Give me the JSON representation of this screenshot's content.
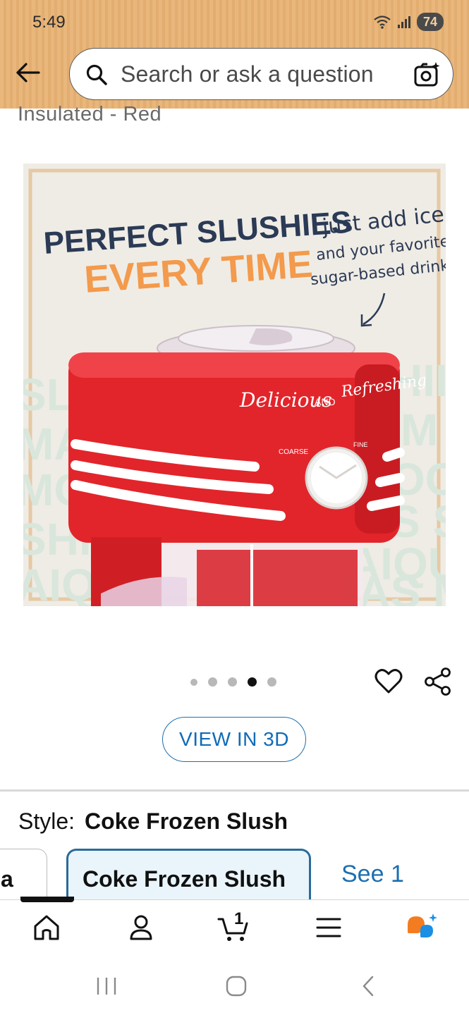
{
  "status_bar": {
    "time": "5:49",
    "battery": "74"
  },
  "search": {
    "placeholder": "Search or ask a question"
  },
  "product": {
    "title_partial": "Insulated - Red",
    "image": {
      "headline_line1": "PERFECT SLUSHIES",
      "headline_line2": "EVERY TIME",
      "note_line1": "just add ice",
      "note_line2": "and your favorite",
      "note_line3": "sugar-based drink",
      "machine_script_1": "Delicious",
      "machine_script_and": "AND",
      "machine_script_2": "Refreshing",
      "dial_left": "COARSE",
      "dial_right": "FINE"
    }
  },
  "carousel": {
    "dot_count": 5,
    "active_index": 3
  },
  "view_3d": {
    "label": "VIEW IN 3D"
  },
  "style": {
    "label": "Style:",
    "value": "Coke Frozen Slush",
    "options": [
      {
        "label": "a",
        "selected": false
      },
      {
        "label": "Coke Frozen Slush",
        "selected": true
      }
    ],
    "see_more": "See 1"
  },
  "bottom_nav": {
    "items": [
      "home-icon",
      "account-icon",
      "cart-icon",
      "menu-icon",
      "rufus-icon"
    ],
    "cart_count": "1",
    "accent_color": "#f47c20",
    "rufus_blue": "#1a8fe3"
  },
  "colors": {
    "header_bg": "#e6b174",
    "link_blue": "#0f6bb8",
    "machine_red": "#e2252b"
  }
}
